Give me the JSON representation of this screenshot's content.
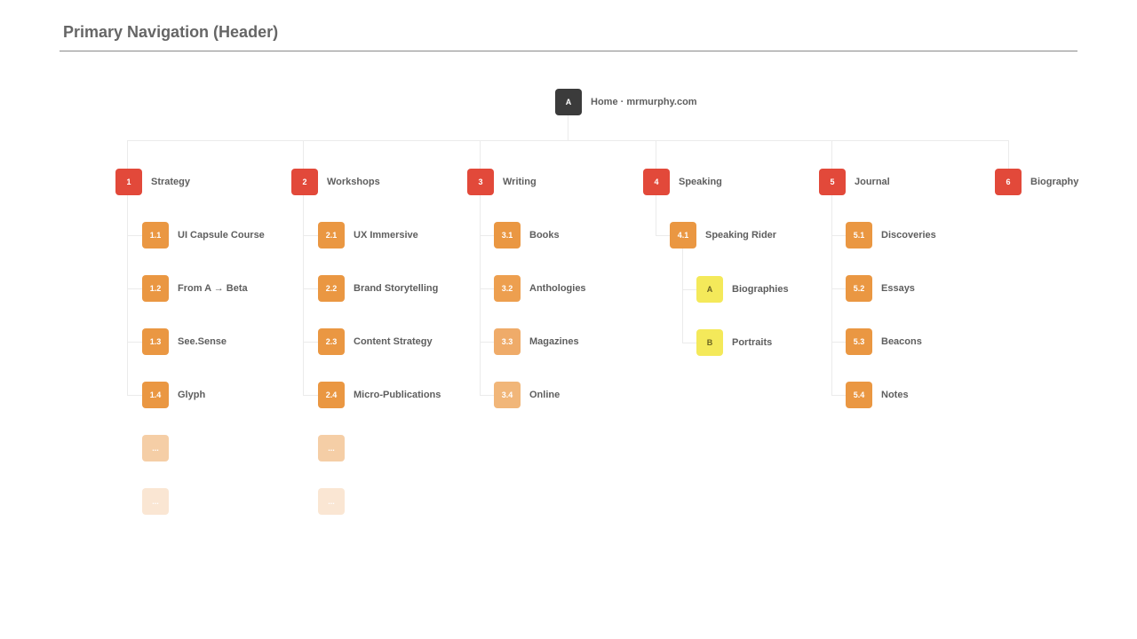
{
  "title": "Primary Navigation (Header)",
  "root": {
    "badge": "A",
    "label": "Home · mrmurphy.com"
  },
  "colors": {
    "root": "#3b3b3b",
    "level1": "#e2493a",
    "level2": "#ea9742",
    "level3": "#f4e95a",
    "placeholder": "#f5cea6"
  },
  "sections": [
    {
      "badge": "1",
      "label": "Strategy",
      "children": [
        {
          "badge": "1.1",
          "label": "UI Capsule Course"
        },
        {
          "badge": "1.2",
          "label": "From A → Beta"
        },
        {
          "badge": "1.3",
          "label": "See.Sense"
        },
        {
          "badge": "1.4",
          "label": "Glyph"
        }
      ],
      "placeholders": [
        "...",
        "..."
      ]
    },
    {
      "badge": "2",
      "label": "Workshops",
      "children": [
        {
          "badge": "2.1",
          "label": "UX Immersive"
        },
        {
          "badge": "2.2",
          "label": "Brand Storytelling"
        },
        {
          "badge": "2.3",
          "label": "Content Strategy"
        },
        {
          "badge": "2.4",
          "label": "Micro-Publications"
        }
      ],
      "placeholders": [
        "...",
        "..."
      ]
    },
    {
      "badge": "3",
      "label": "Writing",
      "children": [
        {
          "badge": "3.1",
          "label": "Books"
        },
        {
          "badge": "3.2",
          "label": "Anthologies"
        },
        {
          "badge": "3.3",
          "label": "Magazines"
        },
        {
          "badge": "3.4",
          "label": "Online"
        }
      ]
    },
    {
      "badge": "4",
      "label": "Speaking",
      "children": [
        {
          "badge": "4.1",
          "label": "Speaking Rider",
          "children": [
            {
              "badge": "A",
              "label": "Biographies"
            },
            {
              "badge": "B",
              "label": "Portraits"
            }
          ]
        }
      ]
    },
    {
      "badge": "5",
      "label": "Journal",
      "children": [
        {
          "badge": "5.1",
          "label": "Discoveries"
        },
        {
          "badge": "5.2",
          "label": "Essays"
        },
        {
          "badge": "5.3",
          "label": "Beacons"
        },
        {
          "badge": "5.4",
          "label": "Notes"
        }
      ]
    },
    {
      "badge": "6",
      "label": "Biography",
      "children": []
    }
  ]
}
